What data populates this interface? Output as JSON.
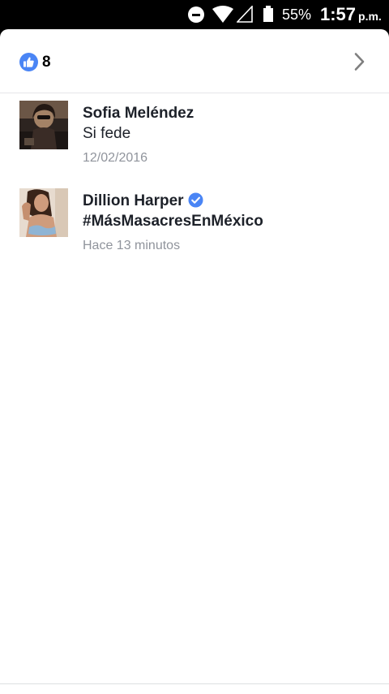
{
  "status_bar": {
    "battery_percent": "55%",
    "time": "1:57",
    "ampm": "p.m.",
    "icons": [
      "do-not-disturb-icon",
      "wifi-icon",
      "signal-icon",
      "battery-icon"
    ]
  },
  "reactions": {
    "icon": "like-icon",
    "count": "8",
    "accent_color": "#4a85f5"
  },
  "items": [
    {
      "name": "Sofia Meléndez",
      "verified": false,
      "text": "Si fede",
      "timestamp": "12/02/2016"
    },
    {
      "name": "Dillion Harper",
      "verified": true,
      "text": "#MásMasacresEnMéxico",
      "timestamp": "Hace 13 minutos"
    }
  ]
}
